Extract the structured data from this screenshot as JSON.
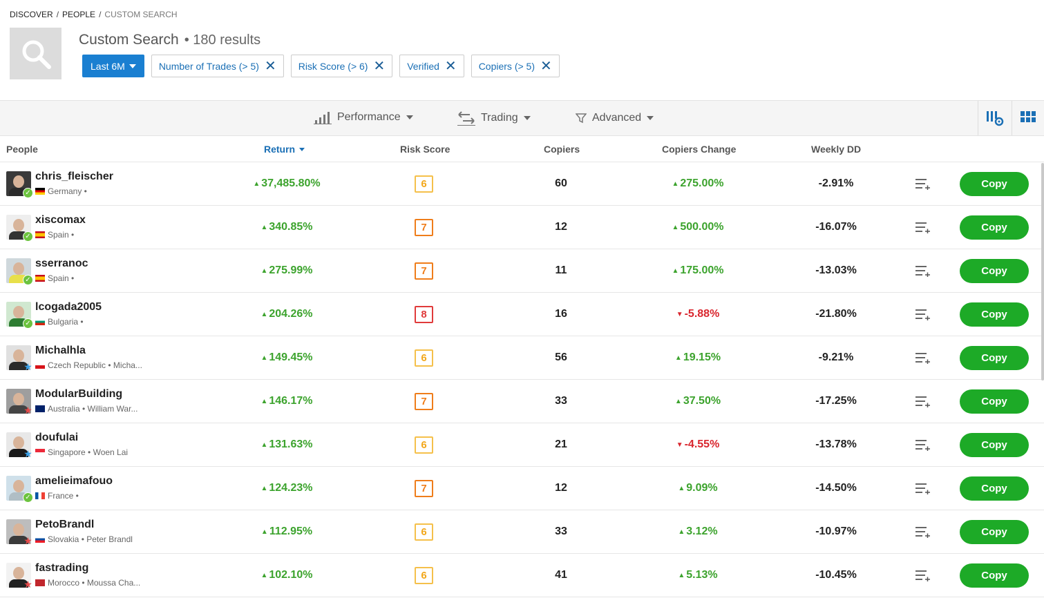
{
  "breadcrumb": {
    "items": [
      "DISCOVER",
      "PEOPLE",
      "CUSTOM SEARCH"
    ],
    "separator": "/"
  },
  "header": {
    "title": "Custom Search",
    "count": "• 180 results"
  },
  "filters": {
    "period": "Last 6M",
    "chips": [
      "Number of Trades (> 5)",
      "Risk Score (> 6)",
      "Verified",
      "Copiers (> 5)"
    ],
    "remove_icon": "close-icon"
  },
  "toolbar": {
    "performance": "Performance",
    "trading": "Trading",
    "advanced": "Advanced"
  },
  "columns": {
    "people": "People",
    "return": "Return",
    "risk": "Risk Score",
    "copiers": "Copiers",
    "copiers_change": "Copiers Change",
    "weekly_dd": "Weekly DD"
  },
  "copy_label": "Copy",
  "colors": {
    "accent": "#1a7fd1",
    "positive": "#3ca32d",
    "negative": "#d9262e",
    "copy_button": "#1daa27"
  },
  "rows": [
    {
      "name": "chris_fleischer",
      "info": "Germany •",
      "flag": "de",
      "badge": "verified",
      "return": "37,485.80%",
      "risk": "6",
      "copiers": "60",
      "change": "275.00%",
      "change_dir": "up",
      "dd": "-2.91%"
    },
    {
      "name": "xiscomax",
      "info": "Spain •",
      "flag": "es",
      "badge": "verified",
      "return": "340.85%",
      "risk": "7",
      "copiers": "12",
      "change": "500.00%",
      "change_dir": "up",
      "dd": "-16.07%"
    },
    {
      "name": "sserranoc",
      "info": "Spain •",
      "flag": "es",
      "badge": "verified",
      "return": "275.99%",
      "risk": "7",
      "copiers": "11",
      "change": "175.00%",
      "change_dir": "up",
      "dd": "-13.03%"
    },
    {
      "name": "lcogada2005",
      "info": "Bulgaria •",
      "flag": "bg",
      "badge": "verified",
      "return": "204.26%",
      "risk": "8",
      "copiers": "16",
      "change": "-5.88%",
      "change_dir": "down",
      "dd": "-21.80%"
    },
    {
      "name": "Michalhla",
      "info": "Czech Republic • Micha...",
      "flag": "cz",
      "badge": "star-blue",
      "return": "149.45%",
      "risk": "6",
      "copiers": "56",
      "change": "19.15%",
      "change_dir": "up",
      "dd": "-9.21%"
    },
    {
      "name": "ModularBuilding",
      "info": "Australia • William War...",
      "flag": "au",
      "badge": "star-red",
      "return": "146.17%",
      "risk": "7",
      "copiers": "33",
      "change": "37.50%",
      "change_dir": "up",
      "dd": "-17.25%"
    },
    {
      "name": "doufulai",
      "info": "Singapore • Woen Lai",
      "flag": "sg",
      "badge": "star-blue",
      "return": "131.63%",
      "risk": "6",
      "copiers": "21",
      "change": "-4.55%",
      "change_dir": "down",
      "dd": "-13.78%"
    },
    {
      "name": "amelieimafouo",
      "info": "France •",
      "flag": "fr",
      "badge": "verified",
      "return": "124.23%",
      "risk": "7",
      "copiers": "12",
      "change": "9.09%",
      "change_dir": "up",
      "dd": "-14.50%"
    },
    {
      "name": "PetoBrandl",
      "info": "Slovakia • Peter Brandl",
      "flag": "sk",
      "badge": "star-red",
      "return": "112.95%",
      "risk": "6",
      "copiers": "33",
      "change": "3.12%",
      "change_dir": "up",
      "dd": "-10.97%"
    },
    {
      "name": "fastrading",
      "info": "Morocco • Moussa Cha...",
      "flag": "ma",
      "badge": "star-red",
      "return": "102.10%",
      "risk": "6",
      "copiers": "41",
      "change": "5.13%",
      "change_dir": "up",
      "dd": "-10.45%"
    }
  ]
}
